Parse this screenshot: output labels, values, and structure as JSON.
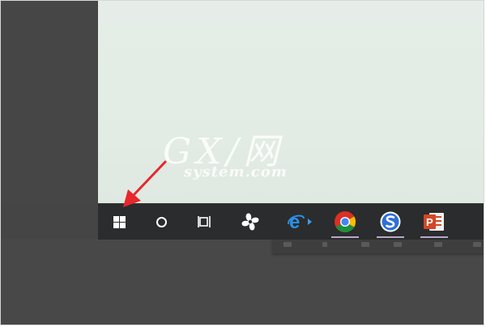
{
  "watermark": {
    "main": "GX/网",
    "sub": "system.com"
  },
  "taskbar": {
    "items": [
      {
        "name": "start-button",
        "icon": "windows-logo-icon"
      },
      {
        "name": "search-button",
        "icon": "cortana-circle-icon"
      },
      {
        "name": "task-view-button",
        "icon": "task-view-icon"
      },
      {
        "name": "pinwheel-app-button",
        "icon": "pinwheel-icon"
      },
      {
        "name": "internet-explorer-button",
        "icon": "internet-explorer-icon"
      },
      {
        "name": "chrome-button",
        "icon": "chrome-icon"
      },
      {
        "name": "sogou-browser-button",
        "icon": "sogou-s-icon"
      },
      {
        "name": "powerpoint-button",
        "icon": "powerpoint-icon",
        "letter": "P"
      }
    ]
  },
  "annotation": {
    "arrow_color": "#e8262c"
  },
  "colors": {
    "taskbar": "#2b2c2d",
    "desktop": "#e3ece5",
    "background": "#454545",
    "underline": "#b7a9c7"
  }
}
